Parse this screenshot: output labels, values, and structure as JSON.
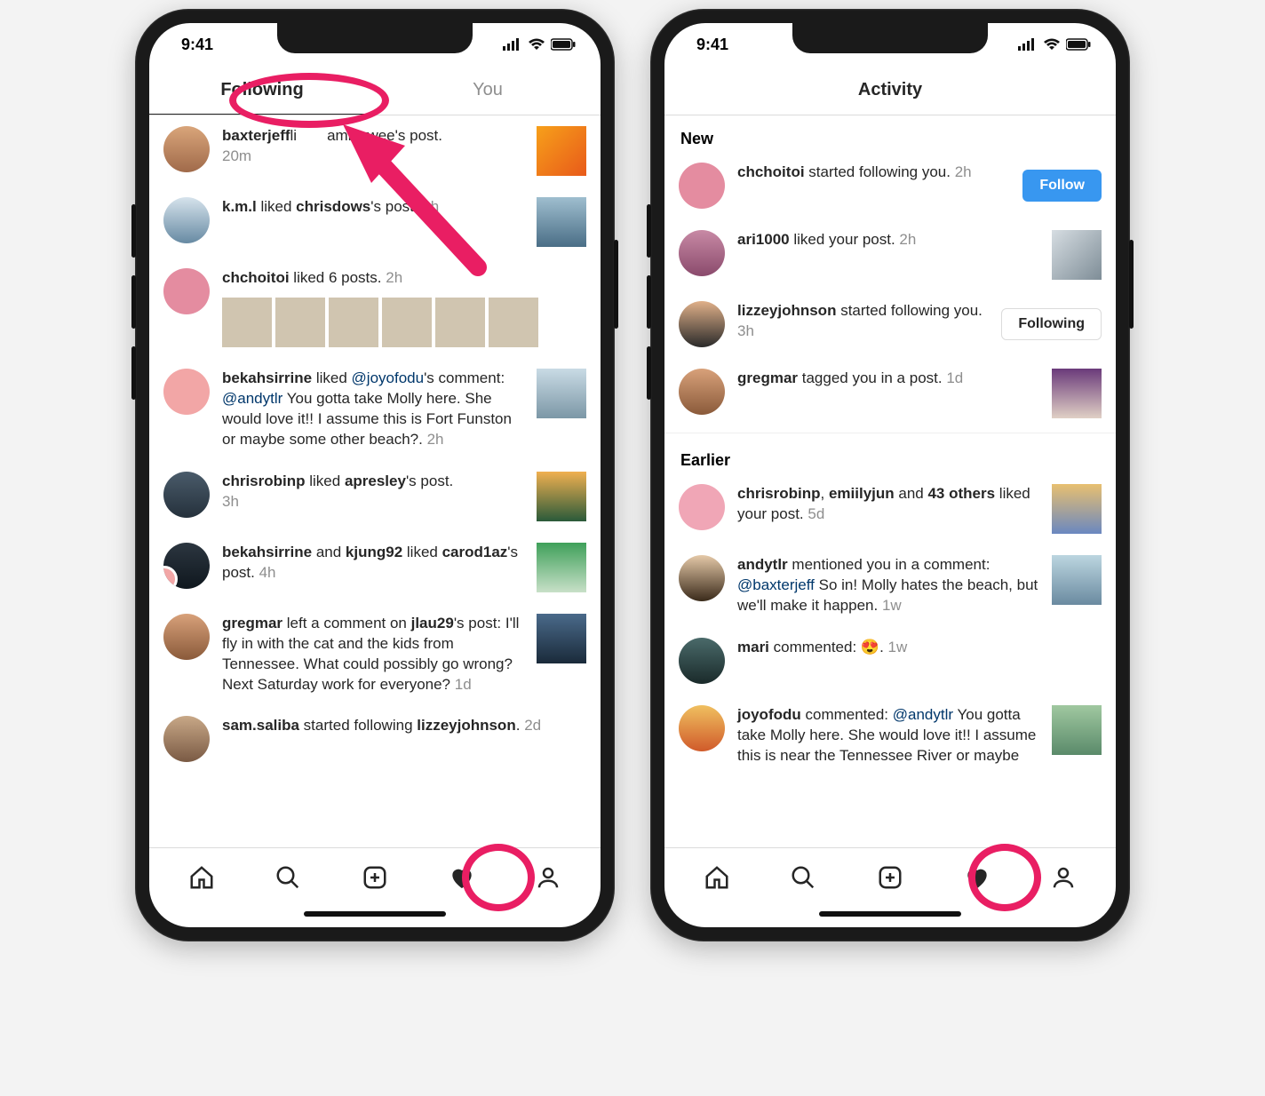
{
  "status": {
    "time": "9:41"
  },
  "left": {
    "tabs": {
      "following": "Following",
      "you": "You",
      "active": "following"
    },
    "items": [
      {
        "user": "baxterjeff",
        "action_prefix": "li",
        "action_obscured": "amiaywee",
        "action_suffix": "'s post.",
        "time": "20m"
      },
      {
        "user": "k.m.l",
        "text_before": " liked ",
        "bold": "chrisdows",
        "text_after": "'s post.",
        "time": "1h"
      },
      {
        "user": "chchoitoi",
        "text": " liked 6 posts.",
        "time": "2h",
        "grid": 6
      },
      {
        "user": "bekahsirrine",
        "rich": " liked ",
        "mention1": "@joyofodu",
        "rich2": "'s comment: ",
        "mention2": "@andytlr",
        "tail": " You gotta take Molly here. She would love it!! I assume this is Fort Funston or maybe some other beach?.",
        "time": "2h"
      },
      {
        "user": "chrisrobinp",
        "text_before": " liked ",
        "bold": "apresley",
        "text_after": "'s post.",
        "time": "3h"
      },
      {
        "user": "bekahsirrine",
        "and": " and ",
        "user2": "kjung92",
        "text_before": " liked ",
        "bold": "carod1az",
        "text_after": "'s post.",
        "time": "4h"
      },
      {
        "user": "gregmar",
        "rich": " left a comment on ",
        "bold": "jlau29",
        "rich2": "'s post:  I'll fly in with the cat and the kids from Tennessee. What could possibly go wrong? Next Saturday work for everyone?",
        "time": "1d"
      },
      {
        "user": "sam.saliba",
        "text_before": " started following ",
        "bold": "lizzeyjohnson",
        "text_after": ".",
        "time": "2d"
      }
    ]
  },
  "right": {
    "title": "Activity",
    "section_new": "New",
    "section_earlier": "Earlier",
    "follow_btn": "Follow",
    "following_btn": "Following",
    "new": [
      {
        "user": "chchoitoi",
        "text": " started following you.",
        "time": "2h",
        "cta": "follow"
      },
      {
        "user": "ari1000",
        "text": " liked your post.",
        "time": "2h",
        "thumb": true
      },
      {
        "user": "lizzeyjohnson",
        "text": " started following you.",
        "time": "3h",
        "cta": "following"
      },
      {
        "user": "gregmar",
        "text": " tagged you in a post.",
        "time": "1d",
        "thumb": true
      }
    ],
    "earlier": [
      {
        "user": "chrisrobinp",
        "user2": "emiilyjun",
        "and": " and ",
        "bold3": "43 others",
        "text": " liked your post.",
        "time": "5d",
        "thumb": true
      },
      {
        "user": "andytlr",
        "rich": " mentioned you in a comment: ",
        "mention": "@baxterjeff",
        "tail": " So in! Molly hates the beach, but we'll make it happen.",
        "time": "1w",
        "thumb": true
      },
      {
        "user": "mari",
        "text": " commented: 😍.",
        "time": "1w"
      },
      {
        "user": "joyofodu",
        "rich": " commented: ",
        "mention": "@andytlr",
        "tail": " You gotta take Molly here. She would love it!! I assume this is near the Tennessee River or maybe",
        "time": "",
        "thumb": true
      }
    ]
  }
}
